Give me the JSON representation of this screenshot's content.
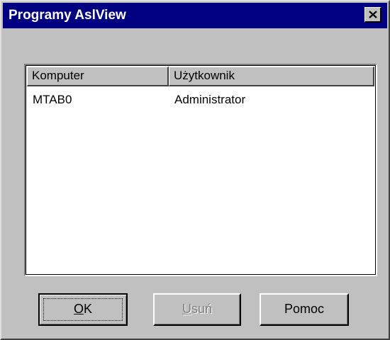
{
  "window": {
    "title": "Programy AslView",
    "close_icon": "close-icon"
  },
  "list": {
    "columns": [
      "Komputer",
      "Użytkownik"
    ],
    "rows": [
      {
        "computer": "MTAB0",
        "user": "Administrator"
      }
    ]
  },
  "buttons": {
    "ok": {
      "mnemonic": "O",
      "rest": "K",
      "enabled": true,
      "focused": true
    },
    "delete": {
      "mnemonic": "U",
      "rest": "suń",
      "enabled": false
    },
    "help": {
      "label": "Pomoc",
      "enabled": true
    }
  },
  "colors": {
    "titlebar": "#000080",
    "face": "#c0c0c0",
    "disabled_text": "#808080"
  }
}
